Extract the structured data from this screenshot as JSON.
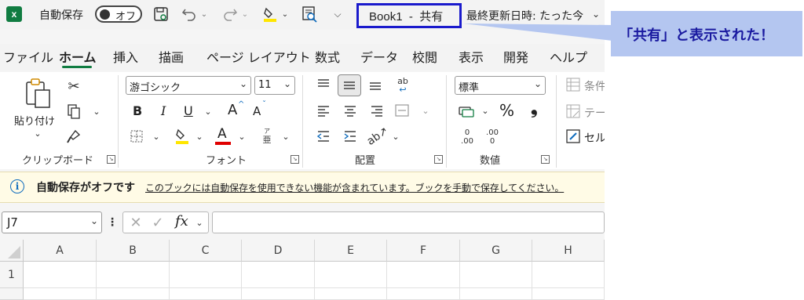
{
  "title_bar": {
    "autosave_label": "自動保存",
    "autosave_toggle": "オフ",
    "document_title": "Book1  -  共有",
    "last_modified": "最終更新日時: たった今"
  },
  "callout": {
    "text": "「共有」と表示された！",
    "border_color": "#1a1acc",
    "bg_color": "#b4c6f0"
  },
  "tabs": [
    {
      "label": "ファイル"
    },
    {
      "label": "ホーム",
      "active": true
    },
    {
      "label": "挿入"
    },
    {
      "label": "描画"
    },
    {
      "label": "ページ レイアウト"
    },
    {
      "label": "数式"
    },
    {
      "label": "データ"
    },
    {
      "label": "校閲"
    },
    {
      "label": "表示"
    },
    {
      "label": "開発"
    },
    {
      "label": "ヘルプ"
    }
  ],
  "ribbon": {
    "clipboard": {
      "paste_label": "貼り付け",
      "group_label": "クリップボード"
    },
    "font": {
      "font_name": "游ゴシック",
      "font_size": "11",
      "bold": "B",
      "italic": "I",
      "underline": "U",
      "grow": "A",
      "shrink": "A",
      "font_color_glyph": "A",
      "phonetic_top": "ア",
      "phonetic_bottom": "亜",
      "group_label": "フォント"
    },
    "alignment": {
      "group_label": "配置",
      "wrap_glyph": "ab"
    },
    "number": {
      "format": "標準",
      "percent": "%",
      "comma": "❟",
      "inc_top": "0",
      "inc_bottom": ".00",
      "dec_top": ".00",
      "dec_bottom": "0",
      "group_label": "数値"
    },
    "styles": {
      "conditional": "条件",
      "table": "テー",
      "cell": "セル"
    }
  },
  "info_bar": {
    "title": "自動保存がオフです",
    "message": "このブックには自動保存を使用できない機能が含まれています。ブックを手動で保存してください。"
  },
  "formula_bar": {
    "name_box": "J7",
    "fx": "fx",
    "value": ""
  },
  "grid": {
    "columns": [
      "A",
      "B",
      "C",
      "D",
      "E",
      "F",
      "G",
      "H"
    ],
    "rows": [
      "1",
      ""
    ]
  },
  "colors": {
    "excel_green": "#107c41",
    "highlight_yellow": "#ffe600",
    "font_red": "#e00000",
    "info_blue": "#0f6cbd"
  }
}
